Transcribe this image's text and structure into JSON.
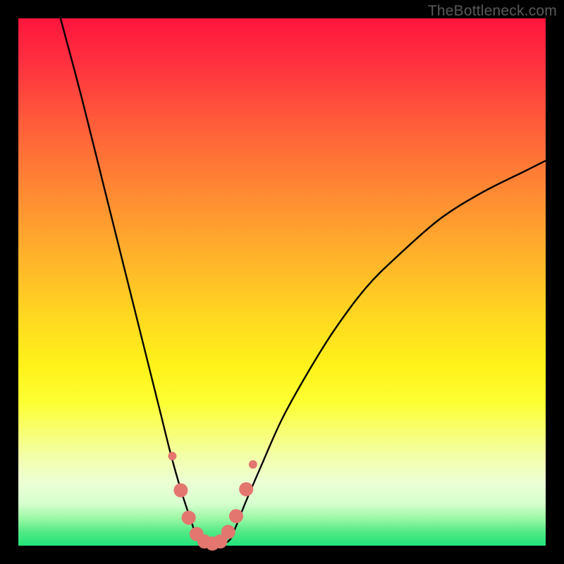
{
  "watermark": "TheBottleneck.com",
  "chart_data": {
    "type": "line",
    "title": "",
    "xlabel": "",
    "ylabel": "",
    "xlim": [
      0,
      100
    ],
    "ylim": [
      0,
      100
    ],
    "grid": false,
    "legend": false,
    "description": "V-shaped bottleneck curve on rainbow gradient background. Y encodes bottleneck severity (top=red=bad, bottom=green=good). Curve reaches minimum (≈0) around x≈34–40.",
    "series": [
      {
        "name": "bottleneck-curve",
        "color": "#000000",
        "x": [
          8,
          12,
          16,
          20,
          24,
          27,
          29,
          31,
          33,
          34,
          36,
          38,
          40,
          41,
          43,
          46,
          50,
          55,
          60,
          66,
          72,
          80,
          88,
          96,
          100
        ],
        "y": [
          100,
          85,
          69,
          53,
          37,
          25,
          17,
          10,
          4,
          1,
          0,
          0,
          1,
          3,
          8,
          15,
          24,
          33,
          41,
          49,
          55,
          62,
          67,
          71,
          73
        ]
      }
    ],
    "markers": {
      "name": "highlight-dots",
      "color": "#e3766f",
      "radius_small": 6,
      "radius_large": 10,
      "points": [
        {
          "x": 29.2,
          "y": 17.0,
          "r": "small"
        },
        {
          "x": 30.8,
          "y": 10.5,
          "r": "large"
        },
        {
          "x": 32.3,
          "y": 5.3,
          "r": "large"
        },
        {
          "x": 33.8,
          "y": 2.2,
          "r": "large"
        },
        {
          "x": 35.3,
          "y": 0.8,
          "r": "large"
        },
        {
          "x": 36.8,
          "y": 0.4,
          "r": "large"
        },
        {
          "x": 38.3,
          "y": 0.8,
          "r": "large"
        },
        {
          "x": 39.8,
          "y": 2.6,
          "r": "large"
        },
        {
          "x": 41.3,
          "y": 5.6,
          "r": "large"
        },
        {
          "x": 43.2,
          "y": 10.7,
          "r": "large"
        },
        {
          "x": 44.5,
          "y": 15.4,
          "r": "small"
        }
      ]
    },
    "gradient_stops": [
      {
        "pos": 0,
        "color": "#ff153d"
      },
      {
        "pos": 0.33,
        "color": "#ff8a33"
      },
      {
        "pos": 0.66,
        "color": "#fff21a"
      },
      {
        "pos": 0.88,
        "color": "#ecffd4"
      },
      {
        "pos": 1.0,
        "color": "#22e37a"
      }
    ]
  }
}
